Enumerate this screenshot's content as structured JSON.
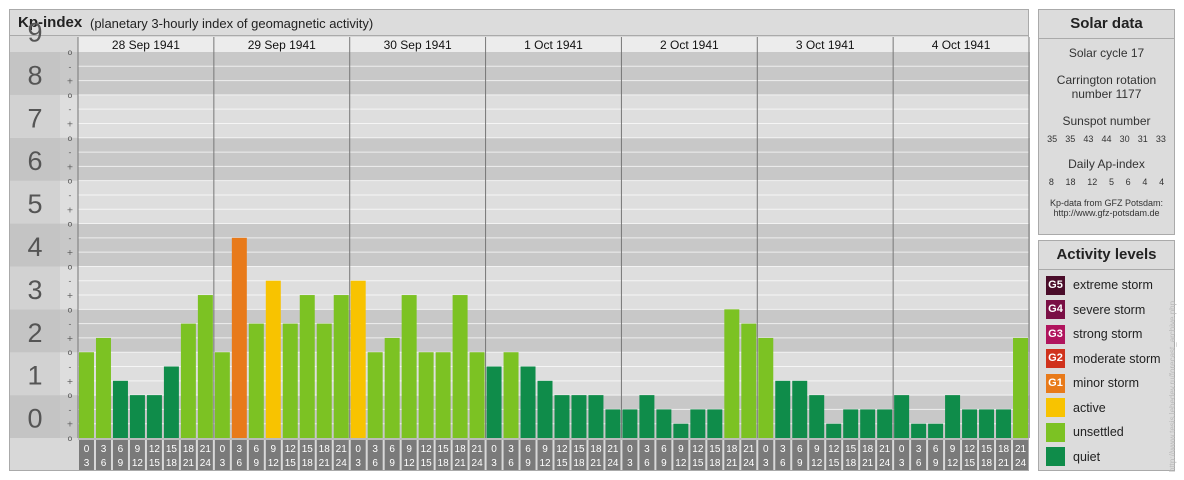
{
  "header": {
    "title": "Kp-index",
    "subtitle": "(planetary 3-hourly index of geomagnetic activity)"
  },
  "chart_data": {
    "type": "bar",
    "title": "Kp-index",
    "subtitle": "(planetary 3-hourly index of geomagnetic activity)",
    "ylim": [
      0,
      9
    ],
    "y_ticks": [
      "0",
      "1",
      "2",
      "3",
      "4",
      "5",
      "6",
      "7",
      "8",
      "9"
    ],
    "minor_tick_labels": [
      "o",
      "+",
      "-"
    ],
    "days": [
      "28 Sep 1941",
      "29 Sep 1941",
      "30 Sep 1941",
      "1 Oct 1941",
      "2 Oct 1941",
      "3 Oct 1941",
      "4 Oct 1941"
    ],
    "slot_start_hours": [
      "0",
      "3",
      "6",
      "9",
      "12",
      "15",
      "18",
      "21"
    ],
    "slot_end_hours": [
      "3",
      "6",
      "9",
      "12",
      "15",
      "18",
      "21",
      "24"
    ],
    "values": [
      2.0,
      2.333,
      1.333,
      1.0,
      1.0,
      1.667,
      2.667,
      3.333,
      2.0,
      4.667,
      2.667,
      3.667,
      2.667,
      3.333,
      2.667,
      3.333,
      3.667,
      2.0,
      2.333,
      3.333,
      2.0,
      2.0,
      3.333,
      2.0,
      1.667,
      2.0,
      1.667,
      1.333,
      1.0,
      1.0,
      1.0,
      0.667,
      0.667,
      1.0,
      0.667,
      0.333,
      0.667,
      0.667,
      3.0,
      2.667,
      2.333,
      1.333,
      1.333,
      1.0,
      0.333,
      0.667,
      0.667,
      0.667,
      1.0,
      0.333,
      0.333,
      1.0,
      0.667,
      0.667,
      0.667,
      2.333
    ],
    "grid": true
  },
  "solar": {
    "title": "Solar data",
    "cycle": "Solar cycle 17",
    "carrington_line1": "Carrington rotation",
    "carrington_line2": "number 1177",
    "sunspot_label": "Sunspot number",
    "sunspot_values": [
      "35",
      "35",
      "43",
      "44",
      "30",
      "31",
      "33"
    ],
    "ap_label": "Daily Ap-index",
    "ap_values": [
      "8",
      "18",
      "12",
      "5",
      "6",
      "4",
      "4"
    ],
    "source_line1": "Kp-data from GFZ Potsdam:",
    "source_line2": "http://www.gfz-potsdam.de"
  },
  "levels": {
    "title": "Activity levels",
    "items": [
      {
        "badge": "G5",
        "label": "extreme storm",
        "color": "#4a0d2a"
      },
      {
        "badge": "G4",
        "label": "severe storm",
        "color": "#7a0f45"
      },
      {
        "badge": "G3",
        "label": "strong storm",
        "color": "#b0145d"
      },
      {
        "badge": "G2",
        "label": "moderate storm",
        "color": "#d0321c"
      },
      {
        "badge": "G1",
        "label": "minor storm",
        "color": "#e87a1a"
      },
      {
        "badge": "",
        "label": "active",
        "color": "#f8c300"
      },
      {
        "badge": "",
        "label": "unsettled",
        "color": "#7cc223"
      },
      {
        "badge": "",
        "label": "quiet",
        "color": "#0f8c4a"
      }
    ]
  },
  "colors": {
    "quiet": "#0f8c4a",
    "unsettled": "#7cc223",
    "active": "#f8c300",
    "g1": "#e87a1a",
    "band_dark": "#c8c8c8",
    "band_light": "#dedede",
    "time_box": "#7a7a7a"
  },
  "watermark": "http://www.tesis.lebedev.ru/forecast_archive.php"
}
